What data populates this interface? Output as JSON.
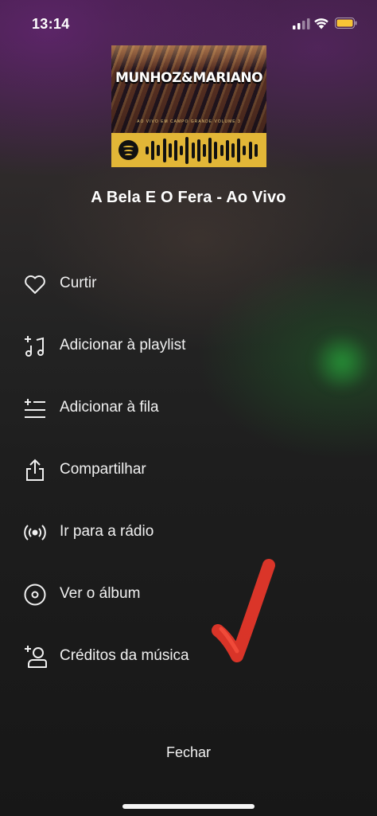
{
  "status_bar": {
    "time": "13:14"
  },
  "album": {
    "artist_text": "MUNHOZ&MARIANO",
    "subtitle_text": "AO VIVO EM CAMPO GRANDE VOLUME 3"
  },
  "track": {
    "title": "A Bela E O Fera - Ao Vivo"
  },
  "menu": {
    "items": [
      {
        "label": "Curtir",
        "icon": "heart-icon"
      },
      {
        "label": "Adicionar à playlist",
        "icon": "add-to-playlist-icon"
      },
      {
        "label": "Adicionar à fila",
        "icon": "add-to-queue-icon"
      },
      {
        "label": "Compartilhar",
        "icon": "share-icon"
      },
      {
        "label": "Ir para a rádio",
        "icon": "radio-icon"
      },
      {
        "label": "Ver o álbum",
        "icon": "album-icon"
      },
      {
        "label": "Créditos da música",
        "icon": "credits-icon"
      }
    ]
  },
  "close_label": "Fechar",
  "colors": {
    "spotify_code_band": "#e2b637",
    "annotation_check": "#e8372a"
  }
}
